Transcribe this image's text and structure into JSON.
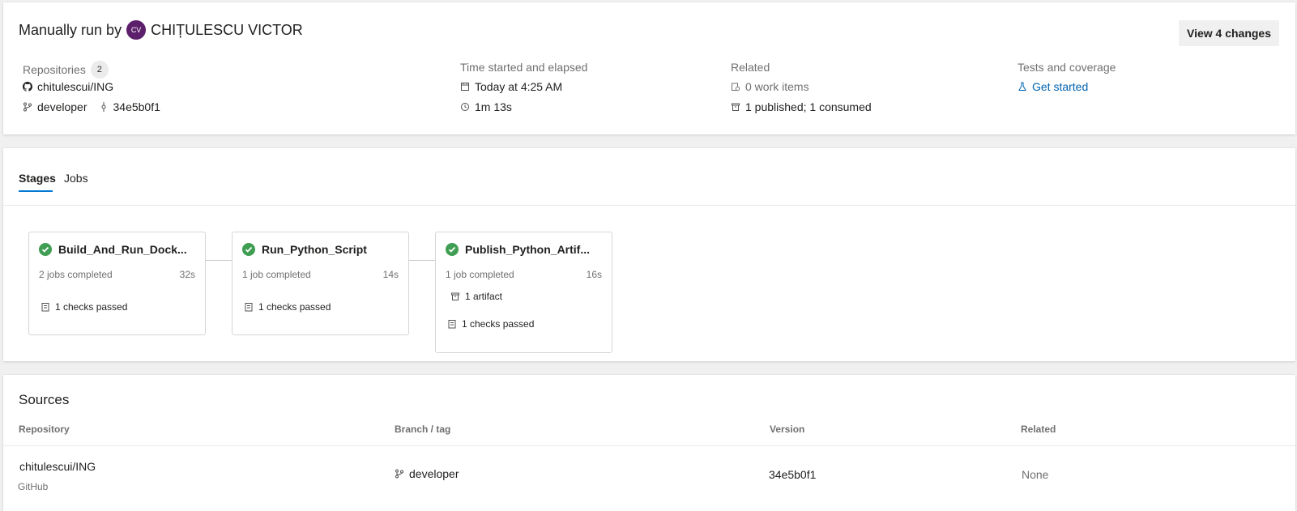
{
  "header": {
    "title_prefix": "Manually run by",
    "avatar_initials": "CV",
    "user_name": "CHIȚULESCU VICTOR",
    "view_changes_label": "View 4 changes"
  },
  "repositories": {
    "label": "Repositories",
    "count": "2",
    "repo": "chitulescui/ING",
    "branch": "developer",
    "commit": "34e5b0f1"
  },
  "time": {
    "label": "Time started and elapsed",
    "started": "Today at 4:25 AM",
    "elapsed": "1m 13s"
  },
  "related": {
    "label": "Related",
    "work_items": "0 work items",
    "artifacts": "1 published; 1 consumed"
  },
  "tests": {
    "label": "Tests and coverage",
    "link": "Get started"
  },
  "tabs": [
    {
      "label": "Stages",
      "active": true
    },
    {
      "label": "Jobs",
      "active": false
    }
  ],
  "stages": [
    {
      "name": "Build_And_Run_Dock...",
      "jobs": "2 jobs completed",
      "duration": "32s",
      "checks": "1 checks passed",
      "artifact": null,
      "status": "succeeded"
    },
    {
      "name": "Run_Python_Script",
      "jobs": "1 job completed",
      "duration": "14s",
      "checks": "1 checks passed",
      "artifact": null,
      "status": "succeeded"
    },
    {
      "name": "Publish_Python_Artif...",
      "jobs": "1 job completed",
      "duration": "16s",
      "checks": "1 checks passed",
      "artifact": "1 artifact",
      "status": "succeeded"
    }
  ],
  "sources": {
    "title": "Sources",
    "columns": [
      "Repository",
      "Branch / tag",
      "Version",
      "Related"
    ],
    "rows": [
      {
        "repository": "chitulescui/ING",
        "provider": "GitHub",
        "branch": "developer",
        "version": "34e5b0f1",
        "related": "None"
      }
    ]
  },
  "colors": {
    "accent": "#0078d4",
    "link": "#0063b1",
    "success": "#3f9e53",
    "avatar": "#5c1f6b"
  }
}
